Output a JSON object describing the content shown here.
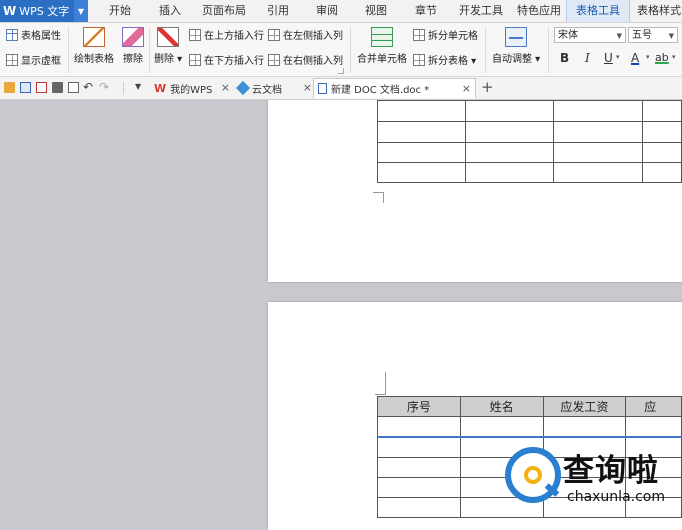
{
  "app": {
    "title": "WPS 文字",
    "logo": "W"
  },
  "menu": {
    "tabs": [
      {
        "label": "开始",
        "active": false
      },
      {
        "label": "插入",
        "active": false
      },
      {
        "label": "页面布局",
        "active": false
      },
      {
        "label": "引用",
        "active": false
      },
      {
        "label": "审阅",
        "active": false
      },
      {
        "label": "视图",
        "active": false
      },
      {
        "label": "章节",
        "active": false
      },
      {
        "label": "开发工具",
        "active": false
      },
      {
        "label": "特色应用",
        "active": false
      },
      {
        "label": "表格工具",
        "active": true
      },
      {
        "label": "表格样式",
        "active": false
      }
    ]
  },
  "ribbon": {
    "table_props": "表格属性",
    "show_gridlines": "显示虚框",
    "draw_table": "绘制表格",
    "erase": "擦除",
    "delete": "删除",
    "insert_above": "在上方插入行",
    "insert_below": "在下方插入行",
    "insert_left": "在左侧插入列",
    "insert_right": "在右侧插入列",
    "merge_cells": "合并单元格",
    "split_cells": "拆分单元格",
    "split_table": "拆分表格",
    "auto_fit": "自动调整",
    "font_name": "宋体",
    "font_size": "五号",
    "bold": "B",
    "italic": "I",
    "underline": "U",
    "font_color": "A",
    "highlight": "ab"
  },
  "doc_tabs": [
    {
      "label": "我的WPS",
      "active": false,
      "closable": true
    },
    {
      "label": "云文档",
      "active": false,
      "closable": true
    },
    {
      "label": "新建 DOC 文档.doc *",
      "active": true,
      "closable": true
    }
  ],
  "table_headers": [
    "序号",
    "姓名",
    "应发工资",
    "应"
  ],
  "watermark": {
    "title": "查询啦",
    "subtitle": "chaxunla.com"
  },
  "colors": {
    "accent": "#2b6fc4",
    "active_tab_text": "#1c58b5",
    "table_header_bg": "#cfcfcf",
    "watermark_blue": "#2a7fd0",
    "watermark_yellow": "#f2b211"
  }
}
